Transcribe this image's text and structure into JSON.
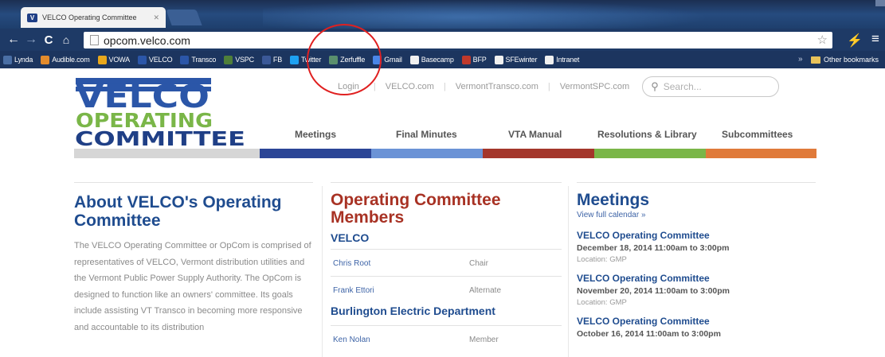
{
  "browser": {
    "tab_title": "VELCO Operating Committee",
    "url": "opcom.velco.com",
    "bookmarks": [
      {
        "label": "Lynda",
        "color": "#4a6fa5",
        "icon": "lynda-icon"
      },
      {
        "label": "Audible.com",
        "color": "#e38b2c",
        "icon": "audible-icon"
      },
      {
        "label": "VOWA",
        "color": "#e9a81c",
        "icon": "vowa-icon"
      },
      {
        "label": "VELCO",
        "color": "#2b56a8",
        "icon": "velco-icon"
      },
      {
        "label": "Transco",
        "color": "#2b56a8",
        "icon": "transco-icon"
      },
      {
        "label": "VSPC",
        "color": "#4f7f3a",
        "icon": "vspc-icon"
      },
      {
        "label": "FB",
        "color": "#3b5998",
        "icon": "facebook-icon"
      },
      {
        "label": "Twitter",
        "color": "#1da1f2",
        "icon": "twitter-icon"
      },
      {
        "label": "Zerfuffle",
        "color": "#5a8f6d",
        "icon": "zerfuffle-icon"
      },
      {
        "label": "Gmail",
        "color": "#4a86e8",
        "icon": "gmail-icon"
      },
      {
        "label": "Basecamp",
        "color": "#f0f0f0",
        "icon": "page-icon"
      },
      {
        "label": "BFP",
        "color": "#c0392b",
        "icon": "bfp-icon"
      },
      {
        "label": "SFEwinter",
        "color": "#f0f0f0",
        "icon": "page-icon"
      },
      {
        "label": "Intranet",
        "color": "#f0f0f0",
        "icon": "page-icon"
      }
    ],
    "other_bookmarks": "Other bookmarks"
  },
  "site": {
    "logo_line1": "VELCO",
    "logo_line2": "OPERATING",
    "logo_line3": "COMMITTEE",
    "utility": {
      "login": "Login",
      "velco": "VELCO.com",
      "transco": "VermontTransco.com",
      "vspc": "VermontSPC.com",
      "search_placeholder": "Search..."
    },
    "nav": {
      "meetings": "Meetings",
      "final_minutes": "Final Minutes",
      "vta_manual": "VTA Manual",
      "resolutions": "Resolutions & Library",
      "subcommittees": "Subcommittees"
    },
    "colors": {
      "navy": "#2b4596",
      "blue": "#6b93d6",
      "red": "#a4362b",
      "green": "#7ab648",
      "orange": "#e07a3a",
      "grey": "#d6d6d6",
      "annotation": "#e02020"
    }
  },
  "about": {
    "title": "About VELCO's Operating Committee",
    "body": "The VELCO Operating Committee or OpCom is comprised of representatives of VELCO, Vermont distribution utilities and the Vermont Public Power Supply Authority. The OpCom is designed to function like an owners' committee. Its goals include assisting VT Transco in becoming more responsive and accountable to its distribution"
  },
  "members": {
    "title": "Operating Committee Members",
    "org1": "VELCO",
    "org1_rows": [
      {
        "name": "Chris Root",
        "role": "Chair"
      },
      {
        "name": "Frank Ettori",
        "role": "Alternate"
      }
    ],
    "org2": "Burlington Electric Department",
    "org2_rows": [
      {
        "name": "Ken Nolan",
        "role": "Member"
      }
    ]
  },
  "meetings": {
    "title": "Meetings",
    "view_all": "View full calendar »",
    "items": [
      {
        "title": "VELCO Operating Committee",
        "date": "December 18, 2014 11:00am to 3:00pm",
        "location": "Location: GMP"
      },
      {
        "title": "VELCO Operating Committee",
        "date": "November 20, 2014 11:00am to 3:00pm",
        "location": "Location: GMP"
      },
      {
        "title": "VELCO Operating Committee",
        "date": "October 16, 2014 11:00am to 3:00pm",
        "location": ""
      }
    ]
  }
}
